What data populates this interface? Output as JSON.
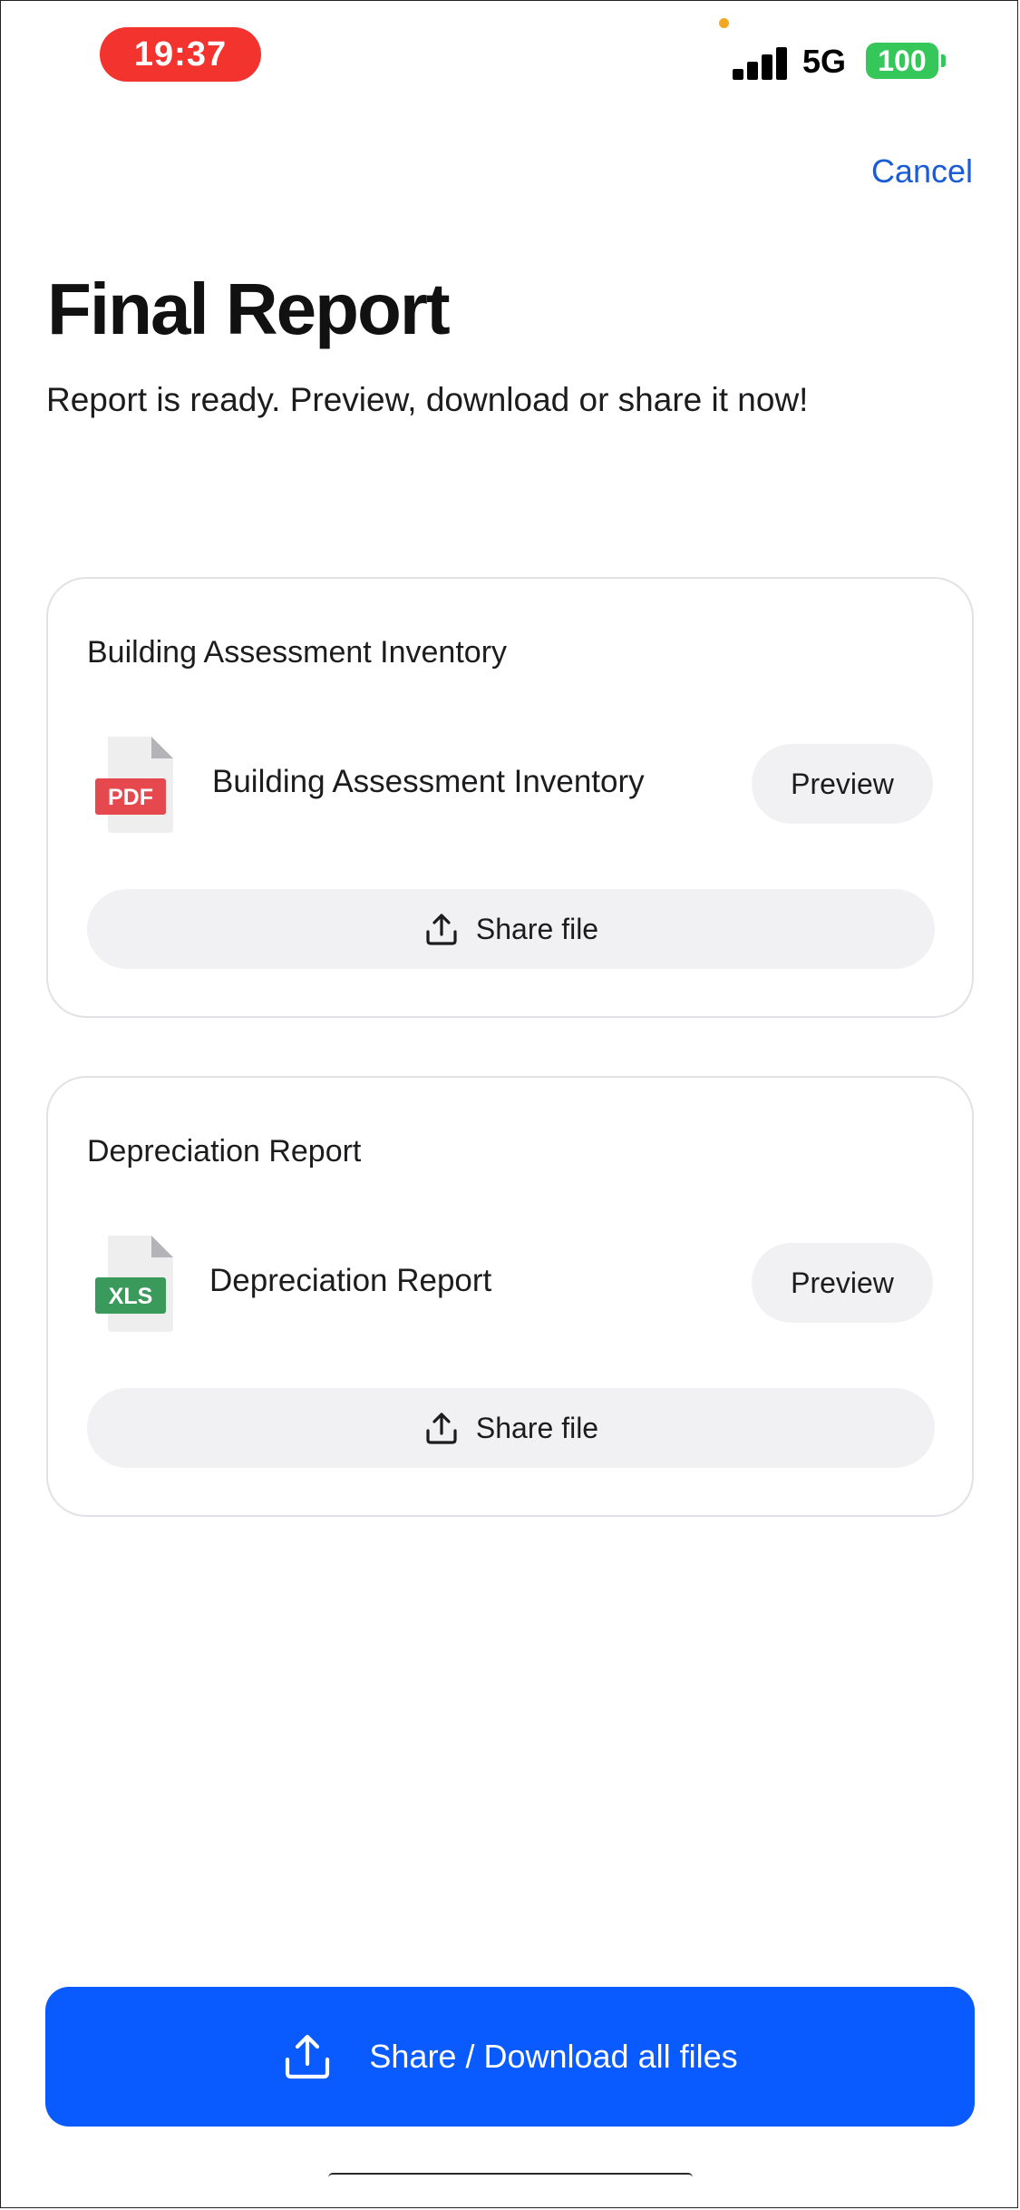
{
  "status_bar": {
    "time": "19:37",
    "network": "5G",
    "battery": "100",
    "colors": {
      "time_pill": "#f2332e",
      "battery": "#35c759",
      "dot": "#f5a623"
    }
  },
  "nav": {
    "cancel_label": "Cancel"
  },
  "header": {
    "title": "Final Report",
    "subtitle": "Report is ready. Preview, download or share it now!"
  },
  "files": [
    {
      "section_title": "Building Assessment Inventory",
      "file_name": "Building Assessment Inventory",
      "file_type": "PDF",
      "file_type_color": "#e5484d",
      "icon": "pdf-file-icon",
      "preview_label": "Preview",
      "share_label": "Share file"
    },
    {
      "section_title": "Depreciation Report",
      "file_name": "Depreciation Report",
      "file_type": "XLS",
      "file_type_color": "#3a9a5b",
      "icon": "xls-file-icon",
      "preview_label": "Preview",
      "share_label": "Share file"
    }
  ],
  "footer": {
    "primary_label": "Share / Download all files",
    "primary_color": "#0a5bff",
    "icon": "upload-icon"
  }
}
